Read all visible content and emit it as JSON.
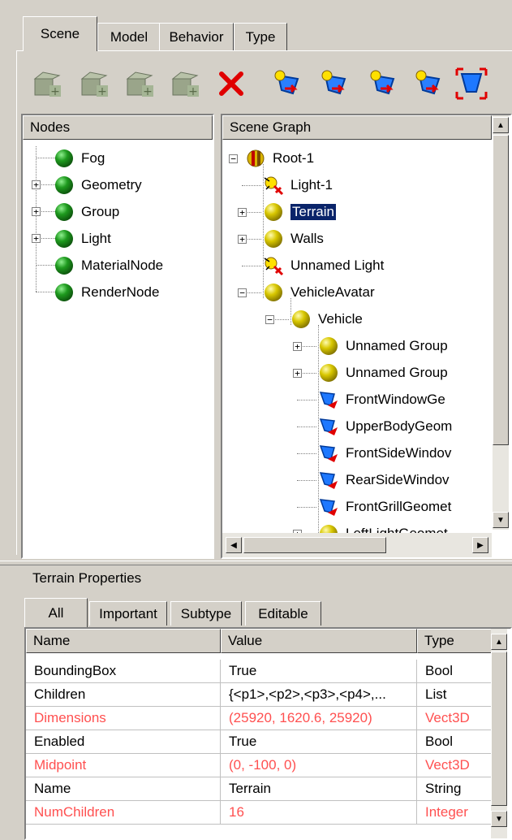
{
  "tabs": [
    "Scene",
    "Model",
    "Behavior",
    "Type"
  ],
  "nodes_panel": {
    "header": "Nodes",
    "items": [
      {
        "label": "Fog",
        "expandable": false
      },
      {
        "label": "Geometry",
        "expandable": true
      },
      {
        "label": "Group",
        "expandable": true
      },
      {
        "label": "Light",
        "expandable": true
      },
      {
        "label": "MaterialNode",
        "expandable": false
      },
      {
        "label": "RenderNode",
        "expandable": false
      }
    ]
  },
  "scene_graph": {
    "header": "Scene Graph",
    "items": [
      {
        "label": "Root-1",
        "icon": "root-icon",
        "expander": "minus"
      },
      {
        "label": "Light-1",
        "icon": "light-icon",
        "expander": ""
      },
      {
        "label": "Terrain",
        "icon": "group-icon",
        "expander": "plus",
        "selected": true
      },
      {
        "label": "Walls",
        "icon": "group-icon",
        "expander": "plus"
      },
      {
        "label": "Unnamed Light",
        "icon": "light-icon",
        "expander": ""
      },
      {
        "label": "VehicleAvatar",
        "icon": "group-icon",
        "expander": "minus"
      },
      {
        "label": "Vehicle",
        "icon": "group-icon",
        "expander": "minus"
      },
      {
        "label": "Unnamed Group",
        "icon": "group-icon",
        "expander": "plus"
      },
      {
        "label": "Unnamed Group",
        "icon": "group-icon",
        "expander": "plus"
      },
      {
        "label": "FrontWindowGe",
        "icon": "geometry-icon",
        "expander": ""
      },
      {
        "label": "UpperBodyGeom",
        "icon": "geometry-icon",
        "expander": ""
      },
      {
        "label": "FrontSideWindov",
        "icon": "geometry-icon",
        "expander": ""
      },
      {
        "label": "RearSideWindov",
        "icon": "geometry-icon",
        "expander": ""
      },
      {
        "label": "FrontGrillGeomet",
        "icon": "geometry-icon",
        "expander": ""
      },
      {
        "label": "LeftLightGeomet",
        "icon": "group-icon",
        "expander": "plus"
      }
    ]
  },
  "properties": {
    "title": "Terrain Properties",
    "subtabs": [
      "All",
      "Important",
      "Subtype",
      "Editable"
    ],
    "columns": [
      "Name",
      "Value",
      "Type"
    ],
    "rows": [
      {
        "name": "BoundingBox",
        "value": "True",
        "type": "Bool",
        "highlight": false
      },
      {
        "name": "Children",
        "value": "{<p1>,<p2>,<p3>,<p4>,...",
        "type": "List",
        "highlight": false
      },
      {
        "name": "Dimensions",
        "value": "(25920, 1620.6, 25920)",
        "type": "Vect3D",
        "highlight": true
      },
      {
        "name": "Enabled",
        "value": "True",
        "type": "Bool",
        "highlight": false
      },
      {
        "name": "Midpoint",
        "value": "(0, -100, 0)",
        "type": "Vect3D",
        "highlight": true
      },
      {
        "name": "Name",
        "value": "Terrain",
        "type": "String",
        "highlight": false
      },
      {
        "name": "NumChildren",
        "value": "16",
        "type": "Integer",
        "highlight": true
      }
    ]
  },
  "colors": {
    "highlight_text": "#ff5050",
    "selection": "#0a246a",
    "face": "#d4d0c8"
  }
}
